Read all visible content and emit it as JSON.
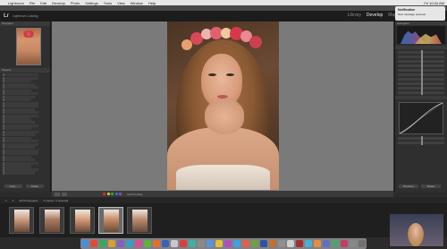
{
  "menubar": {
    "items": [
      "Lightroom",
      "File",
      "Edit",
      "Develop",
      "Photo",
      "Settings",
      "Tools",
      "View",
      "Window",
      "Help"
    ],
    "right": [
      "Fri 10:34 AM"
    ]
  },
  "idplate": {
    "logo": "Lr",
    "catalog": "Lightroom Catalog",
    "modules": [
      "Library",
      "Develop",
      "Map"
    ]
  },
  "notification": {
    "title": "Notification",
    "body": "New message received"
  },
  "left_panel": {
    "navigator": "Navigator",
    "collections": "Presets",
    "copy_button": "Copy...",
    "paste_button": "Paste"
  },
  "right_panel": {
    "histogram": "Histogram",
    "previous_button": "Previous",
    "reset_button": "Reset"
  },
  "toolbar": {
    "label": "Soft Proofing",
    "swatches": [
      "#d43030",
      "#d6c030",
      "#40a040",
      "#3070d0",
      "#9050b0"
    ]
  },
  "filmbar": {
    "items": [
      "1",
      "2",
      "All Photographs",
      "5 photos / 1 selected"
    ]
  },
  "filmstrip": {
    "thumbs": [
      {
        "tone": "#c99a80"
      },
      {
        "tone": "#a97a60"
      },
      {
        "tone": "#d49a78"
      },
      {
        "tone": "#c58a62"
      },
      {
        "tone": "#b88a6f"
      }
    ]
  },
  "dock": {
    "icons": [
      "#4a8ed8",
      "#e04a3a",
      "#3aa85a",
      "#d8a030",
      "#8060c0",
      "#30a0c8",
      "#d05090",
      "#60b040",
      "#e07030",
      "#3a60b8",
      "#c8c8c8",
      "#d84040",
      "#40b0a0",
      "#8a8a8a",
      "#5a90e0",
      "#e0c040",
      "#b050c0",
      "#40a0e0",
      "#e06050",
      "#70a040",
      "#3050a0",
      "#c07030",
      "#909090",
      "#d0d0d0",
      "#a03030",
      "#4ab0d0",
      "#e09040",
      "#6070c0",
      "#50a070",
      "#c04060",
      "#888888",
      "#707070"
    ]
  }
}
